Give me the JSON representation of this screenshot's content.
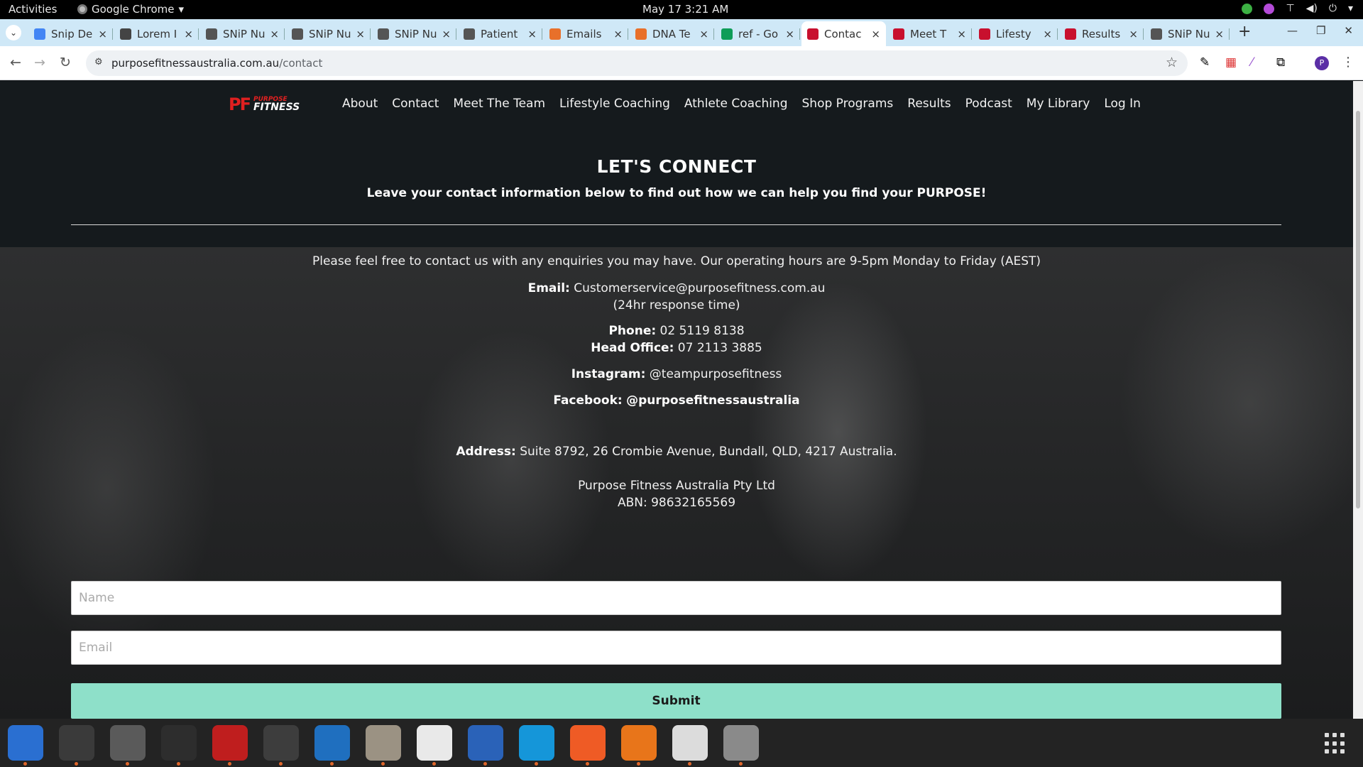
{
  "topbar": {
    "activities": "Activities",
    "app_name": "Google Chrome",
    "clock": "May 17  3:21 AM"
  },
  "tabs": [
    {
      "title": "Snip De",
      "favicon": "docs-icon",
      "color": "#4285f4"
    },
    {
      "title": "Lorem I",
      "favicon": "lorem-icon",
      "color": "#444444"
    },
    {
      "title": "SNiP Nu",
      "favicon": "snip-icon",
      "color": "#555555"
    },
    {
      "title": "SNiP Nu",
      "favicon": "snip-icon",
      "color": "#555555"
    },
    {
      "title": "SNiP Nu",
      "favicon": "snip-icon",
      "color": "#555555"
    },
    {
      "title": "Patient",
      "favicon": "snip-icon",
      "color": "#555555"
    },
    {
      "title": "Emails",
      "favicon": "emails-icon",
      "color": "#e8702a"
    },
    {
      "title": "DNA Te",
      "favicon": "dna-icon",
      "color": "#e8702a"
    },
    {
      "title": "ref - Go",
      "favicon": "sheets-icon",
      "color": "#0f9d58"
    },
    {
      "title": "Contac",
      "favicon": "purpose-fitness-icon",
      "color": "#c8102e",
      "active": true
    },
    {
      "title": "Meet T",
      "favicon": "purpose-fitness-icon",
      "color": "#c8102e"
    },
    {
      "title": "Lifesty",
      "favicon": "purpose-fitness-icon",
      "color": "#c8102e"
    },
    {
      "title": "Results",
      "favicon": "purpose-fitness-icon",
      "color": "#c8102e"
    },
    {
      "title": "SNiP Nu",
      "favicon": "snip-icon",
      "color": "#555555"
    }
  ],
  "toolbar": {
    "url_host": "purposefitnessaustralia.com.au",
    "url_path": "/contact"
  },
  "site": {
    "logo_line1": "PURPOSE",
    "logo_line2": "FITNESS",
    "nav": [
      "About",
      "Contact",
      "Meet The Team",
      "Lifestyle Coaching",
      "Athlete Coaching",
      "Shop Programs",
      "Results",
      "Podcast",
      "My Library",
      "Log In"
    ]
  },
  "hero": {
    "title": "LET'S CONNECT",
    "subtitle": "Leave your contact information below to find out how we can help you find your PURPOSE!"
  },
  "contact": {
    "intro": "Please feel free to contact us with any enquiries you may have. Our operating hours are 9-5pm Monday to Friday (AEST)",
    "email_label": "Email:",
    "email_value": "Customerservice@purposefitness.com.au",
    "response_time": "(24hr response time)",
    "phone_label": "Phone:",
    "phone_value": "02 5119 8138",
    "head_office_label": "Head Office:",
    "head_office_value": "07 2113 3885",
    "instagram_label": "Instagram:",
    "instagram_value": "@teampurposefitness",
    "facebook_label": "Facebook:",
    "facebook_value": "@purposefitnessaustralia",
    "address_label": "Address:",
    "address_value": "Suite 8792, 26 Crombie Avenue, Bundall, QLD, 4217 Australia.",
    "company": "Purpose Fitness Australia Pty Ltd",
    "abn": "ABN: 98632165569"
  },
  "form": {
    "name_placeholder": "Name",
    "email_placeholder": "Email",
    "submit_label": "Submit",
    "accent_color": "#8ee0c9"
  },
  "dock": [
    {
      "name": "thunderbird-icon",
      "color": "#2a6fd1"
    },
    {
      "name": "terminal-icon",
      "color": "#3a3a3a"
    },
    {
      "name": "calculator-icon",
      "color": "#5a5a5a"
    },
    {
      "name": "system-monitor-icon",
      "color": "#2d2d2d"
    },
    {
      "name": "filezilla-icon",
      "color": "#bf1e1e"
    },
    {
      "name": "chrome-icon",
      "color": "#3d3d3d"
    },
    {
      "name": "vscode-icon",
      "color": "#1f6fbf"
    },
    {
      "name": "files-icon",
      "color": "#9b9283"
    },
    {
      "name": "text-editor-icon",
      "color": "#e9e9e9"
    },
    {
      "name": "document-viewer-icon",
      "color": "#2a62b8"
    },
    {
      "name": "skype-icon",
      "color": "#1596d9"
    },
    {
      "name": "postman-icon",
      "color": "#ef5b25"
    },
    {
      "name": "blender-flame-icon",
      "color": "#e8751a"
    },
    {
      "name": "screenshot-tool-icon",
      "color": "#dcdcdc"
    },
    {
      "name": "disks-icon",
      "color": "#8a8a8a"
    }
  ]
}
